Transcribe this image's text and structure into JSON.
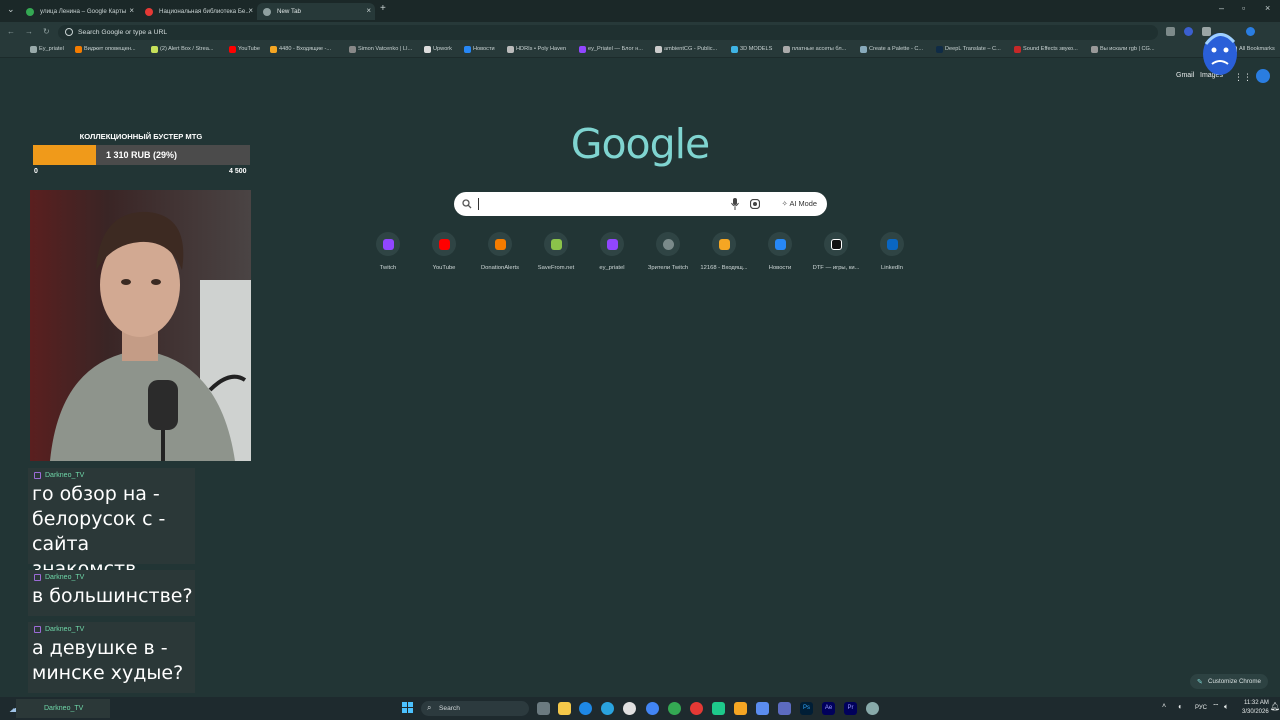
{
  "tabs": [
    {
      "label": "улица Ленина – Google Карты",
      "active": false
    },
    {
      "label": "Национальная библиотека Бе...",
      "active": false
    },
    {
      "label": "New Tab",
      "active": true
    }
  ],
  "omnibox": {
    "placeholder": "Search Google or type a URL"
  },
  "bookmarks": {
    "items": [
      "Ey_priatel",
      "Виджет оповещен...",
      "(2) Alert Box / Strea...",
      "YouTube",
      "4480 - Входящие -...",
      "Simon Vatcenko | LI...",
      "Upwork",
      "Новости",
      "HDRIs • Poly Haven",
      "ey_Priatel — Блог н...",
      "ambientCG - Public...",
      "3D MODELS",
      "платные ассеты бл...",
      "Create a Palette - C...",
      "DeepL Translate – C...",
      "Sound Effects звуко...",
      "Вы искали rgb | CG..."
    ],
    "all_label": "All Bookmarks"
  },
  "google": {
    "logo": "Google",
    "gmail": "Gmail",
    "images": "Images",
    "ai_mode": "AI Mode",
    "customize": "Customize Chrome"
  },
  "shortcuts": [
    {
      "label": "Twitch",
      "icon": "twitch-icon",
      "color": "#9146ff"
    },
    {
      "label": "YouTube",
      "icon": "youtube-icon",
      "color": "#ff0000"
    },
    {
      "label": "DonationAlerts",
      "icon": "donationalerts-icon",
      "color": "#f57c00"
    },
    {
      "label": "SaveFrom.net",
      "icon": "savefrom-icon",
      "color": "#8bc34a"
    },
    {
      "label": "ey_priatel",
      "icon": "twitch-icon",
      "color": "#9146ff"
    },
    {
      "label": "Зрители Twitch",
      "icon": "generic-r-icon",
      "color": "#7a8a8a"
    },
    {
      "label": "12168 - Входящ...",
      "icon": "mail-icon",
      "color": "#f5a623"
    },
    {
      "label": "Новости",
      "icon": "vk-icon",
      "color": "#2787f5"
    },
    {
      "label": "DTF — игры, ки...",
      "icon": "dtf-icon",
      "color": "#111111"
    },
    {
      "label": "LinkedIn",
      "icon": "linkedin-icon",
      "color": "#0a66c2"
    }
  ],
  "overlay": {
    "goal_title": "КОЛЛЕКЦИОННЫЙ БУСТЕР МТG",
    "goal_value": "1 310 RUB (29%)",
    "goal_progress": 0.29,
    "goal_min": "0",
    "goal_max": "4 500"
  },
  "chat": [
    {
      "user": "Darkneo_TV",
      "message": "го обзор на - белорусок с - сайта знакомств"
    },
    {
      "user": "Darkneo_TV",
      "message": "в большинстве?"
    },
    {
      "user": "Darkneo_TV",
      "message": "а девушке в - минске худые?"
    },
    {
      "user": "Darkneo_TV",
      "message": ""
    }
  ],
  "taskbar": {
    "search": "Search",
    "lang": "РУС",
    "time": "11:32 AM",
    "date": "3/30/2026"
  },
  "colors": {
    "accent": "#7fd4d0",
    "background": "#223535",
    "goal_fill": "#f09a1a"
  }
}
